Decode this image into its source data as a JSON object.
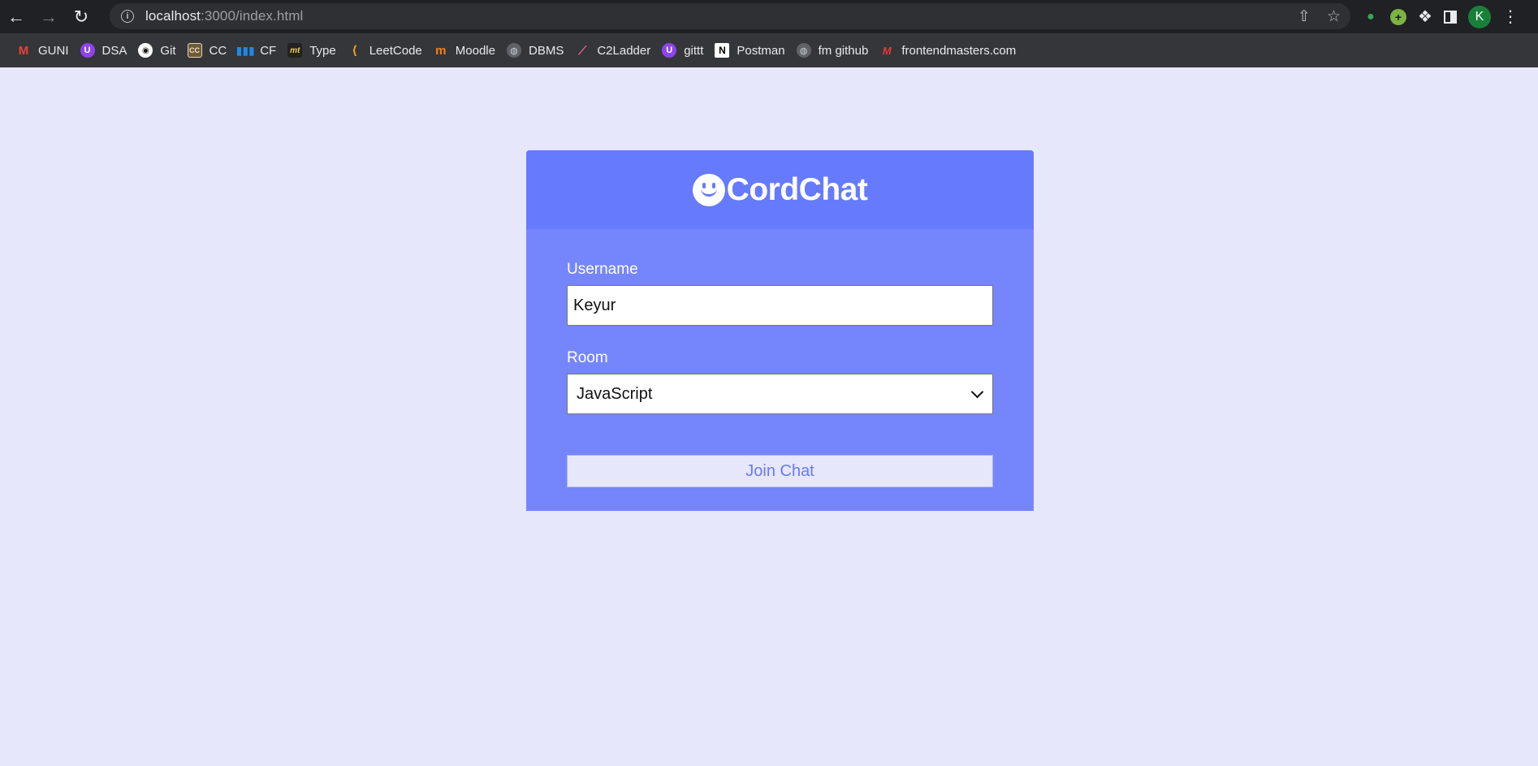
{
  "browser": {
    "url_host": "localhost",
    "url_rest": ":3000/index.html",
    "avatar_letter": "K"
  },
  "bookmarks": [
    {
      "label": "GUNI",
      "icon": "gmail-icon",
      "glyph": "M"
    },
    {
      "label": "DSA",
      "icon": "u-icon",
      "glyph": "U"
    },
    {
      "label": "Git",
      "icon": "github-icon",
      "glyph": "◉"
    },
    {
      "label": "CC",
      "icon": "codechef-icon",
      "glyph": "CC"
    },
    {
      "label": "CF",
      "icon": "codeforces-icon",
      "glyph": "▮▮▮"
    },
    {
      "label": "Type",
      "icon": "monkeytype-icon",
      "glyph": "mt"
    },
    {
      "label": "LeetCode",
      "icon": "leetcode-icon",
      "glyph": "⟨"
    },
    {
      "label": "Moodle",
      "icon": "moodle-icon",
      "glyph": "m"
    },
    {
      "label": "DBMS",
      "icon": "globe-icon",
      "glyph": "◍"
    },
    {
      "label": "C2Ladder",
      "icon": "ladder-icon",
      "glyph": "⟋"
    },
    {
      "label": "gittt",
      "icon": "u-icon",
      "glyph": "U"
    },
    {
      "label": "Postman",
      "icon": "notion-icon",
      "glyph": "N"
    },
    {
      "label": "fm github",
      "icon": "globe-icon",
      "glyph": "◍"
    },
    {
      "label": "frontendmasters.com",
      "icon": "frontendmasters-icon",
      "glyph": "M"
    }
  ],
  "app": {
    "title": "CordChat",
    "username_label": "Username",
    "username_value": "Keyur",
    "room_label": "Room",
    "room_selected": "JavaScript",
    "join_label": "Join Chat"
  },
  "colors": {
    "page_bg": "#e6e7fb",
    "card_header": "#667afe",
    "card_body": "#7586fd"
  }
}
